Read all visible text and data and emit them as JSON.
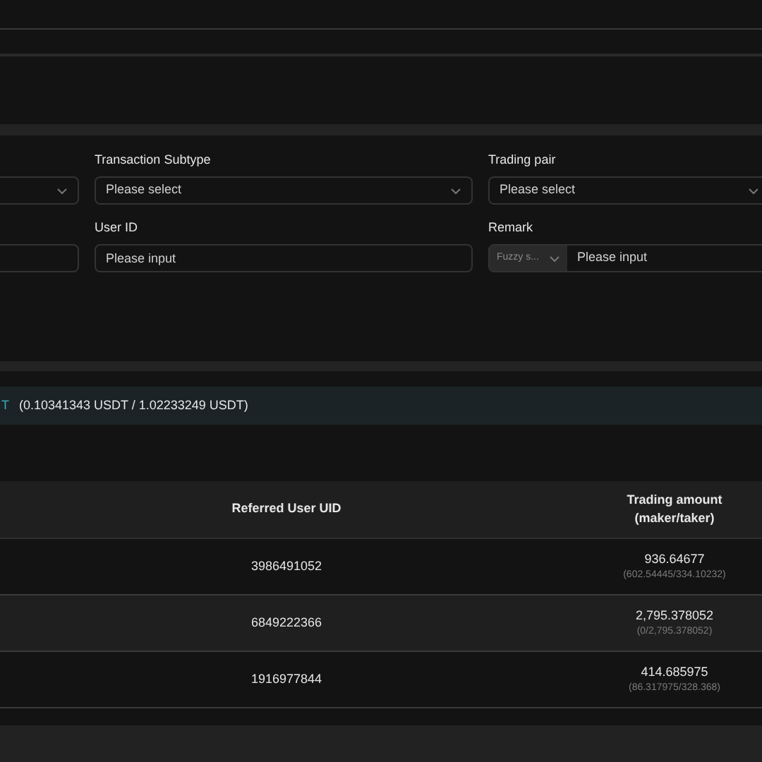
{
  "filters": [
    {
      "kind": "select"
    },
    {
      "kind": "select",
      "label": "Transaction Subtype",
      "placeholder": "Please select"
    },
    {
      "kind": "select",
      "label": "Trading pair",
      "placeholder": "Please select"
    },
    {
      "kind": "input"
    },
    {
      "kind": "input",
      "label": "User ID",
      "placeholder": "Please input"
    },
    {
      "kind": "prefixed",
      "label": "Remark",
      "prefix": "Fuzzy s...",
      "placeholder": "Please input"
    }
  ],
  "summary": {
    "cut_text": "T",
    "text": "(0.10341343 USDT / 1.02233249 USDT)"
  },
  "table": {
    "columns": [
      "Referred User UID",
      "Trading amount (maker/taker)"
    ],
    "rows": [
      {
        "uid": "3986491052",
        "amount": "936.64677",
        "breakdown": "(602.54445/334.10232)"
      },
      {
        "uid": "6849222366",
        "amount": "2,795.378052",
        "breakdown": "(0/2,795.378052)"
      },
      {
        "uid": "1916977844",
        "amount": "414.685975",
        "breakdown": "(86.317975/328.368)"
      }
    ]
  }
}
